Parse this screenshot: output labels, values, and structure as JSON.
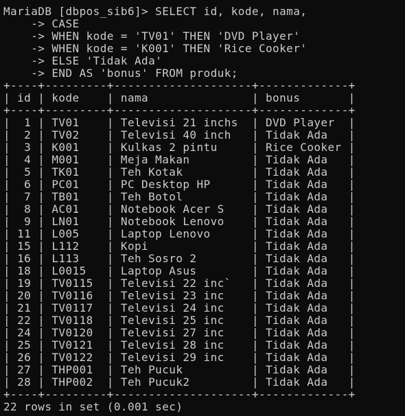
{
  "terminal": {
    "prompt_lines": [
      "MariaDB [dbpos_sib6]> SELECT id, kode, nama,",
      "    -> CASE",
      "    -> WHEN kode = 'TV01' THEN 'DVD Player'",
      "    -> WHEN kode = 'K001' THEN 'Rice Cooker'",
      "    -> ELSE 'Tidak Ada'",
      "    -> END AS 'bonus' FROM produk;"
    ],
    "table_border": "+----+---------+--------------------+-------------+",
    "table_header": "| id | kode    | nama               | bonus       |",
    "table_rows": [
      "|  1 | TV01    | Televisi 21 inchs  | DVD Player  |",
      "|  2 | TV02    | Televisi 40 inch   | Tidak Ada   |",
      "|  3 | K001    | Kulkas 2 pintu     | Rice Cooker |",
      "|  4 | M001    | Meja Makan         | Tidak Ada   |",
      "|  5 | TK01    | Teh Kotak          | Tidak Ada   |",
      "|  6 | PC01    | PC Desktop HP      | Tidak Ada   |",
      "|  7 | TB01    | Teh Botol          | Tidak Ada   |",
      "|  8 | AC01    | Notebook Acer S    | Tidak Ada   |",
      "|  9 | LN01    | Notebook Lenovo    | Tidak Ada   |",
      "| 11 | L005    | Laptop Lenovo      | Tidak Ada   |",
      "| 15 | L112    | Kopi               | Tidak Ada   |",
      "| 16 | L113    | Teh Sosro 2        | Tidak Ada   |",
      "| 18 | L0015   | Laptop Asus        | Tidak Ada   |",
      "| 19 | TV0115  | Televisi 22 inc`   | Tidak Ada   |",
      "| 20 | TV0116  | Televisi 23 inc    | Tidak Ada   |",
      "| 21 | TV0117  | Televisi 24 inc    | Tidak Ada   |",
      "| 22 | TV0118  | Televisi 25 inc    | Tidak Ada   |",
      "| 24 | TV0120  | Televisi 27 inc    | Tidak Ada   |",
      "| 25 | TV0121  | Televisi 28 inc    | Tidak Ada   |",
      "| 26 | TV0122  | Televisi 29 inc    | Tidak Ada   |",
      "| 27 | THP001  | Teh Pucuk          | Tidak Ada   |",
      "| 28 | THP002  | Teh Pucuk2         | Tidak Ada   |"
    ],
    "result_summary": "22 rows in set (0.001 sec)"
  },
  "colors": {
    "background": "#0c0c0c",
    "text": "#cccccc"
  }
}
